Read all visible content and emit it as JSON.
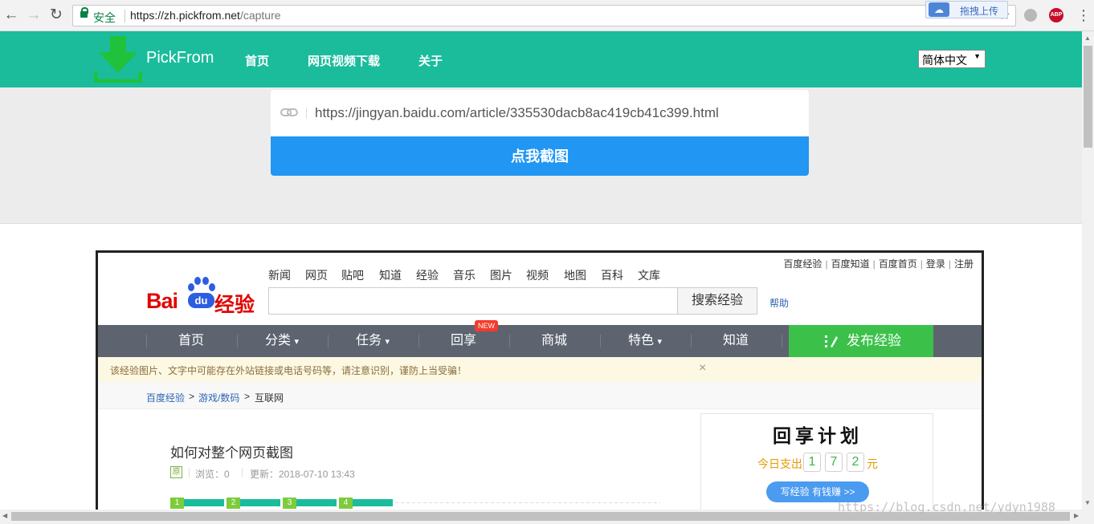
{
  "browser": {
    "address_secure_label": "安全",
    "url_host": "https://zh.pickfrom.net",
    "url_path": "/capture",
    "extension_upload_label": "拖拽上传",
    "abp_label": "ABP"
  },
  "site": {
    "brand": "PickFrom",
    "nav": [
      "首页",
      "网页视频下载",
      "关于"
    ],
    "language_selected": "简体中文",
    "url_input_value": "https://jingyan.baidu.com/article/335530dacb8ac419cb41c399.html",
    "capture_button": "点我截图",
    "accent_color": "#1abc9c",
    "button_color": "#2196f3"
  },
  "preview": {
    "top_links": [
      "百度经验",
      "百度知道",
      "百度首页",
      "登录",
      "注册"
    ],
    "logo": {
      "bai": "Bai",
      "du": "du",
      "jingyan": "经验"
    },
    "nav": [
      "新闻",
      "网页",
      "贴吧",
      "知道",
      "经验",
      "音乐",
      "图片",
      "视频",
      "地图",
      "百科",
      "文库"
    ],
    "search_button": "搜索经验",
    "help_link": "帮助",
    "menu": [
      "首页",
      "分类",
      "任务",
      "回享",
      "商城",
      "特色",
      "知道"
    ],
    "menu_dropdowns": [
      "▾"
    ],
    "new_badge": "NEW",
    "publish_button": "发布经验",
    "warning_text": "该经验图片、文字中可能存在外站链接或电话号码等，请注意识别，谨防上当受骗！",
    "warning_close": "×",
    "breadcrumb": [
      "百度经验",
      ">",
      "游戏/数码",
      ">",
      "互联网"
    ],
    "article_title": "如何对整个网页截图",
    "original_tag": "原",
    "views": "浏览：0",
    "updated": "更新：2018-07-10 13:43",
    "steps": [
      "1",
      "2",
      "3",
      "4"
    ],
    "sidebar": {
      "plan_title": "回享计划",
      "today_label": "今日支出",
      "digits": [
        "1",
        "7",
        "2"
      ],
      "unit": "元",
      "earn_button": "写经验 有钱赚 >>"
    }
  },
  "watermark": "https://blog.csdn.net/ydyn1988"
}
